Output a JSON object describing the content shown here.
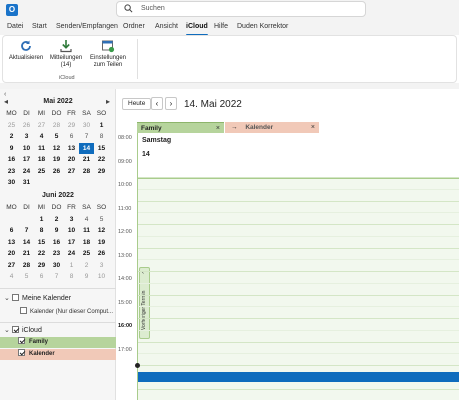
{
  "app": {
    "icon_letter": "O"
  },
  "search": {
    "placeholder": "Suchen"
  },
  "menu": {
    "tabs": [
      "Datei",
      "Start",
      "Senden/Empfangen",
      "Ordner",
      "Ansicht",
      "iCloud",
      "Hilfe",
      "Duden Korrektor"
    ],
    "active": "iCloud"
  },
  "ribbon": {
    "buttons": [
      {
        "label_line1": "Aktualisieren",
        "label_line2": "",
        "icon": "refresh-icon"
      },
      {
        "label_line1": "Mitteilungen",
        "label_line2": "(14)",
        "icon": "download-icon"
      },
      {
        "label_line1": "Einstellungen",
        "label_line2": "zum Teilen",
        "icon": "share-settings-icon"
      }
    ],
    "group_label": "iCloud"
  },
  "nav": {
    "may": {
      "title": "Mai 2022",
      "weekdays": [
        "MO",
        "DI",
        "MI",
        "DO",
        "FR",
        "SA",
        "SO"
      ],
      "rows": [
        [
          "25",
          "26",
          "27",
          "28",
          "29",
          "30",
          "1"
        ],
        [
          "2",
          "3",
          "4",
          "5",
          "6",
          "7",
          "8"
        ],
        [
          "9",
          "10",
          "11",
          "12",
          "13",
          "14",
          "15"
        ],
        [
          "16",
          "17",
          "18",
          "19",
          "20",
          "21",
          "22"
        ],
        [
          "23",
          "24",
          "25",
          "26",
          "27",
          "28",
          "29"
        ],
        [
          "30",
          "31",
          "",
          "",
          "",
          "",
          ""
        ]
      ],
      "selected": "14"
    },
    "june": {
      "title": "Juni 2022",
      "weekdays": [
        "MO",
        "DI",
        "MI",
        "DO",
        "FR",
        "SA",
        "SO"
      ],
      "rows": [
        [
          "",
          "",
          "1",
          "2",
          "3",
          "4",
          "5"
        ],
        [
          "6",
          "7",
          "8",
          "9",
          "10",
          "11",
          "12"
        ],
        [
          "13",
          "14",
          "15",
          "16",
          "17",
          "18",
          "19"
        ],
        [
          "20",
          "21",
          "22",
          "23",
          "24",
          "25",
          "26"
        ],
        [
          "27",
          "28",
          "29",
          "30",
          "1",
          "2",
          "3"
        ],
        [
          "4",
          "5",
          "6",
          "7",
          "8",
          "9",
          "10"
        ]
      ]
    },
    "groups": {
      "my_calendars": "Meine Kalender",
      "my_calendar_item": "Kalender (Nur dieser Comput...",
      "icloud": "iCloud",
      "family": "Family",
      "kalender": "Kalender"
    },
    "colors": {
      "family": "#b6d49c",
      "kalender": "#f1c9b8",
      "selected_day": "#0f6cbd"
    }
  },
  "main": {
    "today_button": "Heute",
    "prev_arrow": "‹",
    "next_arrow": "›",
    "date_title": "14. Mai 2022",
    "tabs": {
      "family": "Family",
      "kalender": "Kalender",
      "close": "×",
      "overlay_arrow": "→"
    },
    "day": {
      "name": "Samstag",
      "number": "14"
    },
    "times": [
      "08:00",
      "09:00",
      "10:00",
      "11:00",
      "12:00",
      "13:00",
      "14:00",
      "15:00",
      "16:00",
      "17:00"
    ],
    "current_time": "16:00",
    "previous_appointment": "Vorheriger Termin",
    "busy_color": "#0f6cbd"
  }
}
